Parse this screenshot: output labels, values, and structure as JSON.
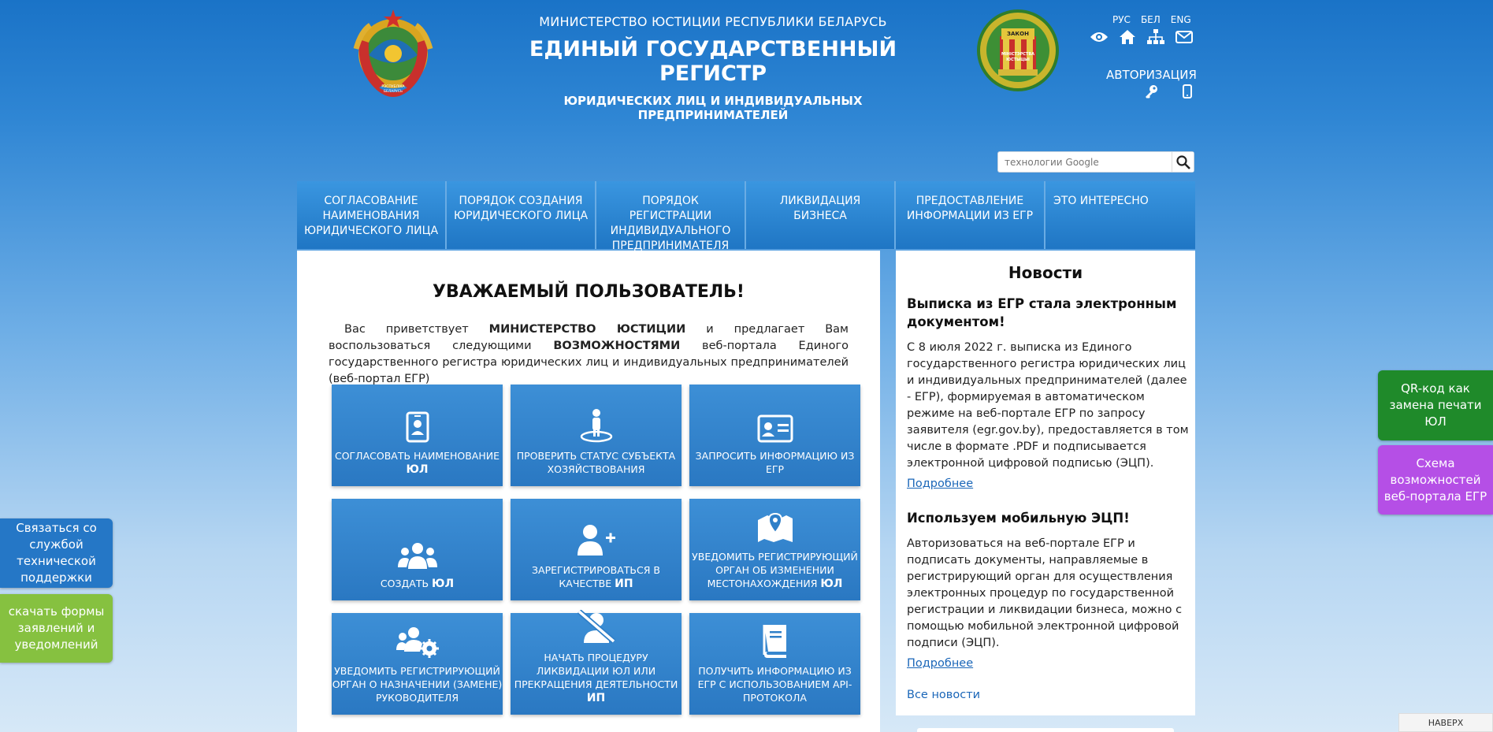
{
  "header": {
    "ministry": "МИНИСТЕРСТВО ЮСТИЦИИ РЕСПУБЛИКИ БЕЛАРУСЬ",
    "title": "ЕДИНЫЙ ГОСУДАРСТВЕННЫЙ РЕГИСТР",
    "subtitle": "ЮРИДИЧЕСКИХ ЛИЦ И ИНДИВИДУАЛЬНЫХ ПРЕДПРИНИМАТЕЛЕЙ",
    "left_emblem_text": "РЭСПУБЛІКА БЕЛАРУСЬ",
    "right_emblem_top": "ЗАКОН",
    "right_emblem_text": "МІНІСТЭРСТВА ЮСТЫЦЫІ"
  },
  "languages": [
    "РУС",
    "БЕЛ",
    "ENG"
  ],
  "tool_icons": [
    "eye-icon",
    "home-icon",
    "sitemap-icon",
    "mail-icon"
  ],
  "auth": {
    "label": "АВТОРИЗАЦИЯ",
    "icons": [
      "key-icon",
      "mobile-icon"
    ]
  },
  "search": {
    "placeholder": "технологии Google"
  },
  "nav": [
    "СОГЛАСОВАНИЕ НАИМЕНОВАНИЯ ЮРИДИЧЕСКОГО ЛИЦА",
    "ПОРЯДОК СОЗДАНИЯ ЮРИДИЧЕСКОГО ЛИЦА",
    "ПОРЯДОК РЕГИСТРАЦИИ ИНДИВИДУАЛЬНОГО ПРЕДПРИНИМАТЕЛЯ",
    "ЛИКВИДАЦИЯ БИЗНЕСА",
    "ПРЕДОСТАВЛЕНИЕ ИНФОРМАЦИИ ИЗ ЕГР",
    "ЭТО ИНТЕРЕСНО"
  ],
  "main": {
    "greeting": "УВАЖАЕМЫЙ ПОЛЬЗОВАТЕЛЬ!",
    "intro_1": "Вас приветствует ",
    "intro_2": "МИНИСТЕРСТВО ЮСТИЦИИ",
    "intro_3": " и предлагает Вам воспользоваться следующими ",
    "intro_4": "ВОЗМОЖНОСТЯМИ",
    "intro_5": " веб-портала Единого государственного регистра юридических лиц и индивидуальных предпринимателей (веб-портал ЕГР)",
    "tiles": [
      {
        "icon": "id-badge-icon",
        "text": "СОГЛАСОВАТЬ НАИМЕНОВАНИЕ ",
        "bold": "ЮЛ"
      },
      {
        "icon": "person-location-icon",
        "text": "ПРОВЕРИТЬ СТАТУС СУБЪЕКТА ХОЗЯЙСТВОВАНИЯ",
        "bold": ""
      },
      {
        "icon": "id-card-icon",
        "text": "ЗАПРОСИТЬ ИНФОРМАЦИЮ ИЗ ЕГР",
        "bold": ""
      },
      {
        "icon": "users-icon",
        "text": "СОЗДАТЬ ",
        "bold": "ЮЛ"
      },
      {
        "icon": "user-plus-icon",
        "text": "ЗАРЕГИСТРИРОВАТЬСЯ В КАЧЕСТВЕ ",
        "bold": "ИП"
      },
      {
        "icon": "map-marker-icon",
        "text": "УВЕДОМИТЬ РЕГИСТРИРУЮЩИЙ ОРГАН ОБ ИЗМЕНЕНИИ МЕСТОНАХОЖДЕНИЯ ",
        "bold": "ЮЛ"
      },
      {
        "icon": "users-cog-icon",
        "text": "УВЕДОМИТЬ РЕГИСТРИРУЮЩИЙ ОРГАН О НАЗНАЧЕНИИ (ЗАМЕНЕ) РУКОВОДИТЕЛЯ",
        "bold": ""
      },
      {
        "icon": "user-slash-icon",
        "text": "НАЧАТЬ ПРОЦЕДУРУ ЛИКВИДАЦИИ ЮЛ ИЛИ ПРЕКРАЩЕНИЯ ДЕЯТЕЛЬНОСТИ ",
        "bold": "ИП"
      },
      {
        "icon": "book-icon",
        "text": "ПОЛУЧИТЬ ИНФОРМАЦИЮ ИЗ ЕГР С ИСПОЛЬЗОВАНИЕМ API-ПРОТОКОЛА",
        "bold": ""
      }
    ]
  },
  "news": {
    "title": "Новости",
    "items": [
      {
        "headline": "Выписка из ЕГР стала электронным документом!",
        "body": "С 8 июля 2022 г. выписка из Единого государственного регистра юридических лиц и индивидуальных предпринимателей (далее - ЕГР), формируемая в автоматическом режиме на веб-портале ЕГР по запросу заявителя (egr.gov.by), предоставляется в том числе в формате .PDF и подписывается электронной цифровой подписью (ЭЦП).",
        "link": "Подробнее"
      },
      {
        "headline": "Используем мобильную ЭЦП!",
        "body": "Авторизоваться на веб-портале ЕГР и подписать документы, направляемые в регистрирующий орган для осуществления электронных процедур по государственной регистрации и ликвидации бизнеса, можно с помощью мобильной электронной цифровой подписи (ЭЦП).",
        "link": "Подробнее"
      }
    ],
    "all_link": "Все новости"
  },
  "floating": {
    "support": "Связаться со службой технической поддержки",
    "forms": "скачать формы заявлений и уведомлений",
    "qr": "QR-код как замена печати ЮЛ",
    "scheme": "Схема возможностей веб-портала ЕГР"
  },
  "to_top": "НАВЕРХ",
  "colors": {
    "nav": "#2a82d0",
    "tile": "#2f7fc8",
    "support": "#2577c6",
    "forms": "#86c140",
    "qr": "#1f8a2a",
    "scheme": "#b54fe6"
  }
}
